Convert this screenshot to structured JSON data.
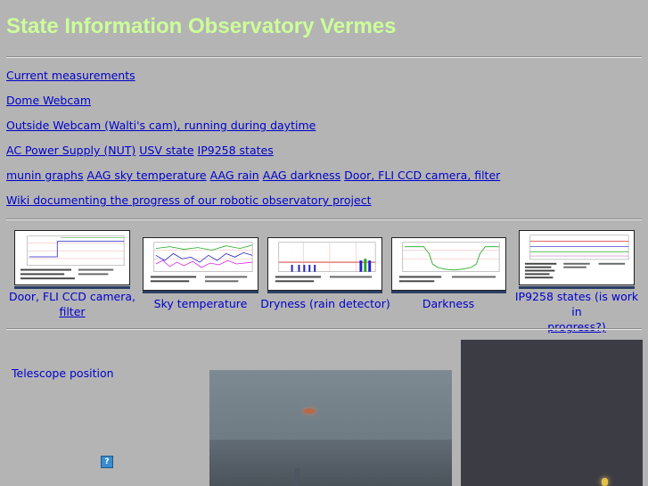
{
  "page": {
    "title": "State Information Observatory Vermes"
  },
  "links": {
    "row1": [
      "Current measurements"
    ],
    "row2": [
      "Dome Webcam"
    ],
    "row3": [
      "Outside Webcam (Walti's cam), running during daytime"
    ],
    "row4": [
      "AC Power Supply (NUT)",
      "USV state",
      "IP9258 states"
    ],
    "row5": [
      "munin graphs",
      "AAG sky temperature",
      "AAG rain",
      "AAG darkness",
      "Door, FLI CCD camera, filter"
    ],
    "row6": [
      "Wiki documenting the progress of our robotic observatory project"
    ]
  },
  "thumbnails": [
    {
      "caption_line1": "Door, FLI CCD camera,",
      "caption_line2": "filter",
      "icon": "door-ccd-graph"
    },
    {
      "caption_line1": "Sky temperature",
      "caption_line2": "",
      "icon": "sky-temperature-graph"
    },
    {
      "caption_line1": "Dryness (rain detector)",
      "caption_line2": "",
      "icon": "rain-detector-graph"
    },
    {
      "caption_line1": "Darkness",
      "caption_line2": "",
      "icon": "darkness-graph"
    },
    {
      "caption_line1": "IP9258 states (is work in",
      "caption_line2": "progress?)",
      "icon": "ip9258-graph"
    }
  ],
  "telescope": {
    "label": "Telescope position",
    "help_icon": "?"
  },
  "colors": {
    "background": "#b4b4b4",
    "title": "#ccff99",
    "link": "#0000cc"
  }
}
